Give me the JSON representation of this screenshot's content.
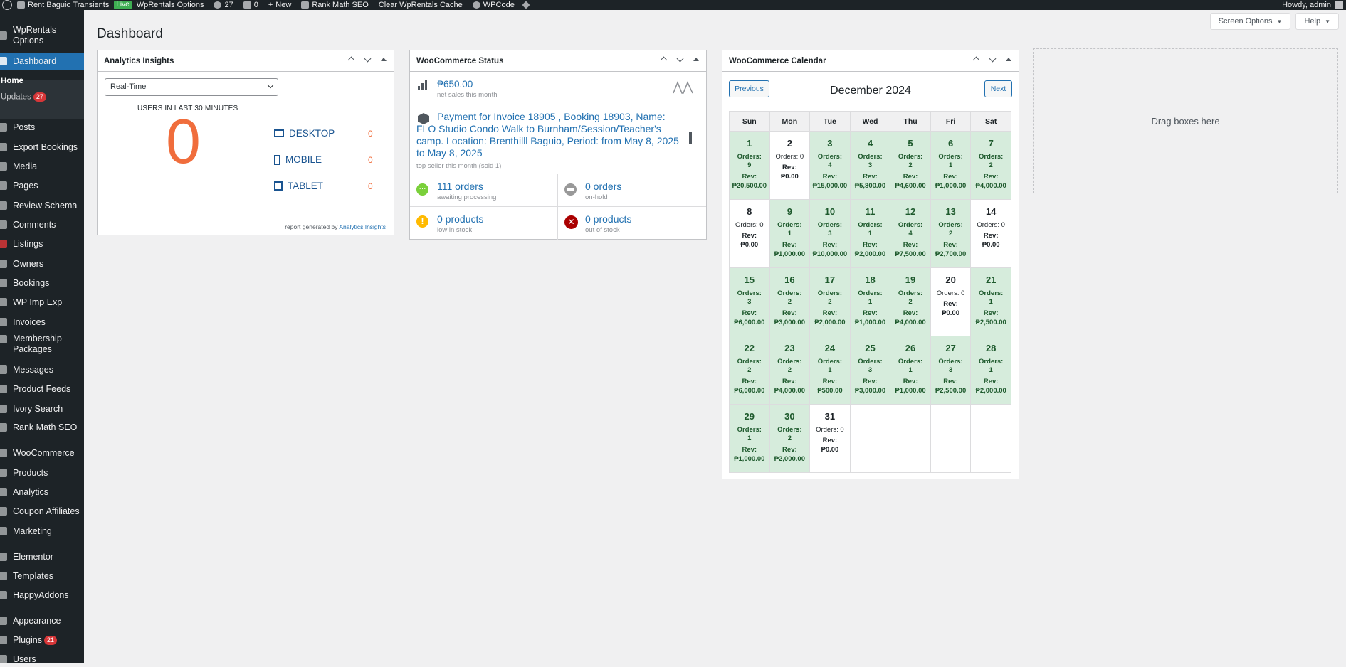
{
  "adminbar": {
    "site": "Rent Baguio Transients",
    "live": "Live",
    "wprentals": "WpRentals Options",
    "updates": "27",
    "comments": "0",
    "new": "New",
    "rankmath": "Rank Math SEO",
    "clearcache": "Clear WpRentals Cache",
    "wpcode": "WPCode",
    "howdy": "Howdy, admin"
  },
  "sidebar": {
    "wprentals_options": "WpRentals Options",
    "dashboard": "Dashboard",
    "home": "Home",
    "updates": "Updates",
    "updates_count": "27",
    "posts": "Posts",
    "export_bookings": "Export Bookings",
    "media": "Media",
    "pages": "Pages",
    "review_schema": "Review Schema",
    "comments": "Comments",
    "listings": "Listings",
    "owners": "Owners",
    "bookings": "Bookings",
    "wp_imp_exp": "WP Imp Exp",
    "invoices": "Invoices",
    "membership": "Membership Packages",
    "messages": "Messages",
    "product_feeds": "Product Feeds",
    "ivory_search": "Ivory Search",
    "rank_math": "Rank Math SEO",
    "woocommerce": "WooCommerce",
    "products": "Products",
    "analytics": "Analytics",
    "coupon_affiliates": "Coupon Affiliates",
    "marketing": "Marketing",
    "elementor": "Elementor",
    "templates": "Templates",
    "happyaddons": "HappyAddons",
    "appearance": "Appearance",
    "plugins": "Plugins",
    "plugins_count": "21",
    "users": "Users"
  },
  "screen_options": "Screen Options",
  "help": "Help",
  "page_title": "Dashboard",
  "analytics": {
    "title": "Analytics Insights",
    "select_value": "Real-Time",
    "users_label": "USERS IN LAST 30 MINUTES",
    "big_value": "0",
    "desktop": "DESKTOP",
    "desktop_val": "0",
    "mobile": "MOBILE",
    "mobile_val": "0",
    "tablet": "TABLET",
    "tablet_val": "0",
    "report_prefix": "report generated by",
    "report_link": "Analytics Insights"
  },
  "woo_status": {
    "title": "WooCommerce Status",
    "net_sales": "₱650.00",
    "net_sales_label": "net sales this month",
    "top_seller": "Payment for Invoice 18905 , Booking 18903, Name: FLO Studio Condo Walk to Burnham/Session/Teacher's camp. Location: Brenthilll Baguio, Period: from May 8, 2025 to May 8, 2025",
    "top_seller_label": "top seller this month (sold 1)",
    "processing": "111 orders",
    "processing_label": "awaiting processing",
    "onhold": "0 orders",
    "onhold_label": "on-hold",
    "lowstock": "0 products",
    "lowstock_label": "low in stock",
    "outstock": "0 products",
    "outstock_label": "out of stock"
  },
  "calendar": {
    "title": "WooCommerce Calendar",
    "prev": "Previous",
    "next": "Next",
    "month": "December 2024",
    "weekdays": [
      "Sun",
      "Mon",
      "Tue",
      "Wed",
      "Thu",
      "Fri",
      "Sat"
    ],
    "days": [
      {
        "d": "1",
        "o": "Orders: 9",
        "r": "Rev: ₱20,500.00",
        "has": true
      },
      {
        "d": "2",
        "o": "Orders: 0",
        "r": "Rev: ₱0.00",
        "has": false
      },
      {
        "d": "3",
        "o": "Orders: 4",
        "r": "Rev: ₱15,000.00",
        "has": true
      },
      {
        "d": "4",
        "o": "Orders: 3",
        "r": "Rev: ₱5,800.00",
        "has": true
      },
      {
        "d": "5",
        "o": "Orders: 2",
        "r": "Rev: ₱4,600.00",
        "has": true
      },
      {
        "d": "6",
        "o": "Orders: 1",
        "r": "Rev: ₱1,000.00",
        "has": true
      },
      {
        "d": "7",
        "o": "Orders: 2",
        "r": "Rev: ₱4,000.00",
        "has": true
      },
      {
        "d": "8",
        "o": "Orders: 0",
        "r": "Rev: ₱0.00",
        "has": false
      },
      {
        "d": "9",
        "o": "Orders: 1",
        "r": "Rev: ₱1,000.00",
        "has": true
      },
      {
        "d": "10",
        "o": "Orders: 3",
        "r": "Rev: ₱10,000.00",
        "has": true
      },
      {
        "d": "11",
        "o": "Orders: 1",
        "r": "Rev: ₱2,000.00",
        "has": true
      },
      {
        "d": "12",
        "o": "Orders: 4",
        "r": "Rev: ₱7,500.00",
        "has": true
      },
      {
        "d": "13",
        "o": "Orders: 2",
        "r": "Rev: ₱2,700.00",
        "has": true
      },
      {
        "d": "14",
        "o": "Orders: 0",
        "r": "Rev: ₱0.00",
        "has": false
      },
      {
        "d": "15",
        "o": "Orders: 3",
        "r": "Rev: ₱6,000.00",
        "has": true
      },
      {
        "d": "16",
        "o": "Orders: 2",
        "r": "Rev: ₱3,000.00",
        "has": true
      },
      {
        "d": "17",
        "o": "Orders: 2",
        "r": "Rev: ₱2,000.00",
        "has": true
      },
      {
        "d": "18",
        "o": "Orders: 1",
        "r": "Rev: ₱1,000.00",
        "has": true
      },
      {
        "d": "19",
        "o": "Orders: 2",
        "r": "Rev: ₱4,000.00",
        "has": true
      },
      {
        "d": "20",
        "o": "Orders: 0",
        "r": "Rev: ₱0.00",
        "has": false
      },
      {
        "d": "21",
        "o": "Orders: 1",
        "r": "Rev: ₱2,500.00",
        "has": true
      },
      {
        "d": "22",
        "o": "Orders: 2",
        "r": "Rev: ₱6,000.00",
        "has": true
      },
      {
        "d": "23",
        "o": "Orders: 2",
        "r": "Rev: ₱4,000.00",
        "has": true
      },
      {
        "d": "24",
        "o": "Orders: 1",
        "r": "Rev: ₱500.00",
        "has": true
      },
      {
        "d": "25",
        "o": "Orders: 3",
        "r": "Rev: ₱3,000.00",
        "has": true
      },
      {
        "d": "26",
        "o": "Orders: 1",
        "r": "Rev: ₱1,000.00",
        "has": true
      },
      {
        "d": "27",
        "o": "Orders: 3",
        "r": "Rev: ₱2,500.00",
        "has": true
      },
      {
        "d": "28",
        "o": "Orders: 1",
        "r": "Rev: ₱2,000.00",
        "has": true
      },
      {
        "d": "29",
        "o": "Orders: 1",
        "r": "Rev: ₱1,000.00",
        "has": true
      },
      {
        "d": "30",
        "o": "Orders: 2",
        "r": "Rev: ₱2,000.00",
        "has": true
      },
      {
        "d": "31",
        "o": "Orders: 0",
        "r": "Rev: ₱0.00",
        "has": false
      }
    ]
  },
  "dropzone": "Drag boxes here",
  "colors": {
    "accent": "#2271b1",
    "adminbar": "#1d2327",
    "calendar_highlight": "#d6ecdc",
    "analytics_number": "#f06d3c"
  }
}
